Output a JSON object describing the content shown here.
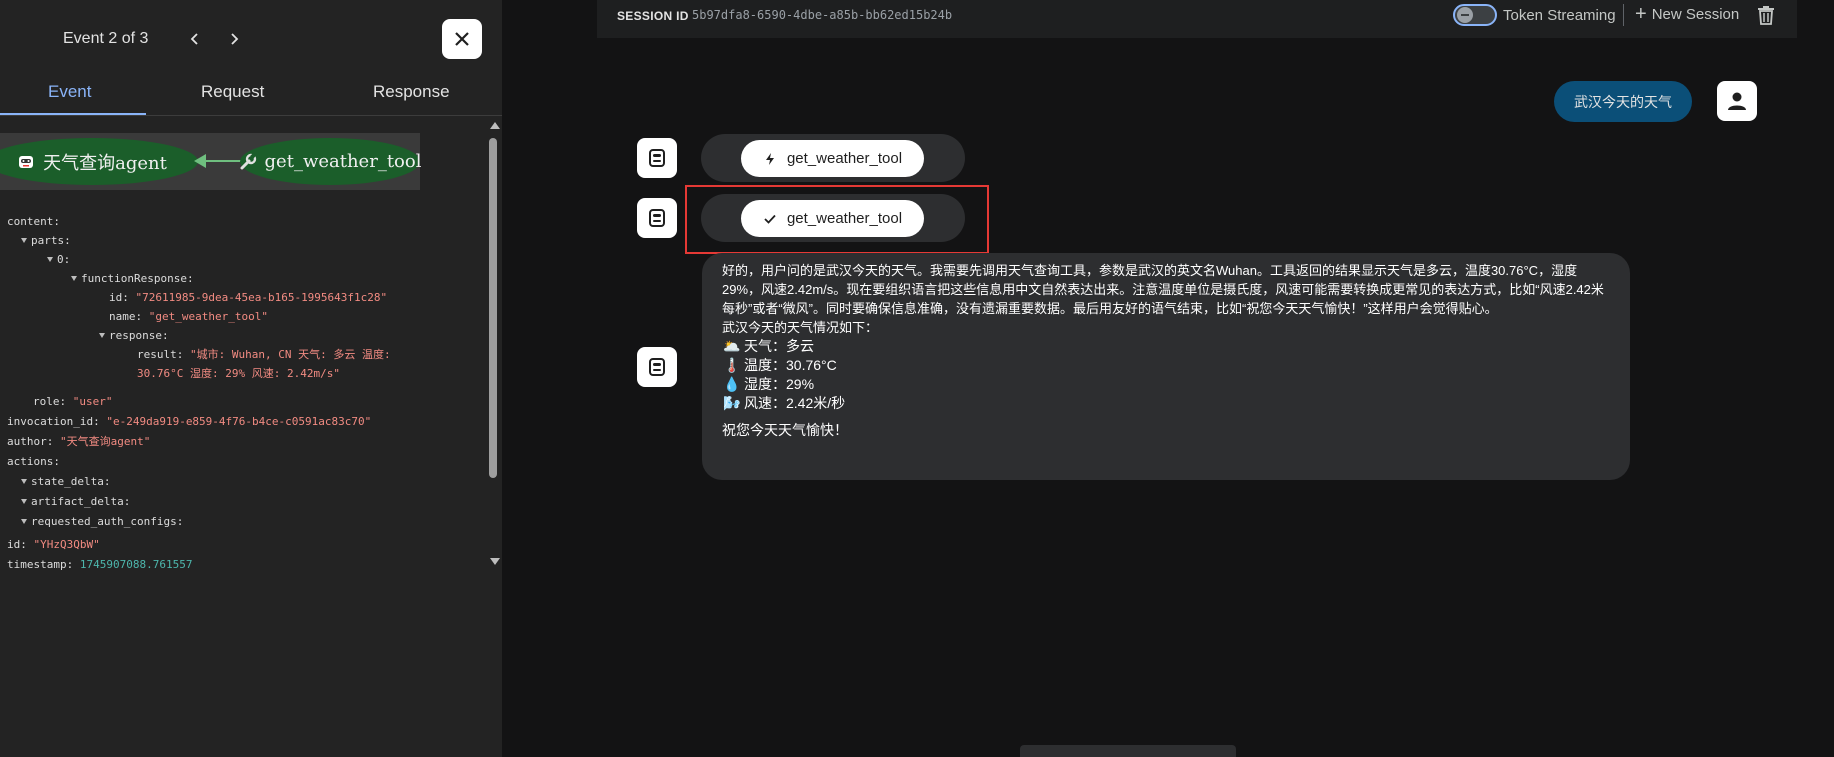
{
  "event_panel": {
    "title": "Event 2 of 3",
    "tabs": [
      "Event",
      "Request",
      "Response"
    ],
    "active_tab": "Event",
    "graph": {
      "agent_node": "天气查询agent",
      "tool_node": "get_weather_tool"
    },
    "json_lines": {
      "content": "content:",
      "parts": "parts:",
      "idx0": "0:",
      "functionResponse": "functionResponse:",
      "id_key": "id:",
      "id_val": "\"72611985-9dea-45ea-b165-1995643f1c28\"",
      "name_key": "name:",
      "name_val": "\"get_weather_tool\"",
      "response": "response:",
      "result_key": "result:",
      "result_val1": "\"城市: Wuhan, CN 天气: 多云 温度:",
      "result_val2": "30.76°C 湿度: 29% 风速: 2.42m/s\"",
      "role_key": "role:",
      "role_val": "\"user\"",
      "invocation_key": "invocation_id:",
      "invocation_val": "\"e-249da919-e859-4f76-b4ce-c0591ac83c70\"",
      "author_key": "author:",
      "author_val": "\"天气查询agent\"",
      "actions": "actions:",
      "state_delta": "state_delta:",
      "artifact_delta": "artifact_delta:",
      "requested_auth_configs": "requested_auth_configs:",
      "eid_key": "id:",
      "eid_val": "\"YHzQ3QbW\"",
      "timestamp_key": "timestamp:",
      "timestamp_val": "1745907088.761557"
    }
  },
  "session": {
    "label": "SESSION ID",
    "id": "5b97dfa8-6590-4dbe-a85b-bb62ed15b24b",
    "token_streaming_label": "Token Streaming",
    "token_streaming_on": false,
    "new_session_label": "New Session"
  },
  "chat": {
    "user_message": "武汉今天的天气",
    "tool_call_label": "get_weather_tool",
    "tool_response_label": "get_weather_tool",
    "answer": {
      "thinking": "好的，用户问的是武汉今天的天气。我需要先调用天气查询工具，参数是武汉的英文名Wuhan。工具返回的结果显示天气是多云，温度30.76°C，湿度29%，风速2.42m/s。现在要组织语言把这些信息用中文自然表达出来。注意温度单位是摄氏度，风速可能需要转换成更常见的表达方式，比如“风速2.42米每秒”或者“微风”。同时要确保信息准确，没有遗漏重要数据。最后用友好的语气结束，比如“祝您今天天气愉快！”这样用户会觉得贴心。",
      "intro": "武汉今天的天气情况如下：",
      "items": [
        {
          "icon": "sun-cloud-icon",
          "emoji": "🌥️",
          "text": "天气：多云"
        },
        {
          "icon": "thermometer-icon",
          "emoji": "🌡️",
          "text": "温度：30.76°C"
        },
        {
          "icon": "droplet-icon",
          "emoji": "💧",
          "text": "湿度：29%"
        },
        {
          "icon": "wind-icon",
          "emoji": "🌬️",
          "text": "风速：2.42米/秒"
        }
      ],
      "closing": "祝您今天天气愉快！"
    }
  },
  "colors": {
    "accent_blue": "#8ab4f8",
    "user_bubble": "#0b4f78",
    "graph_node": "#1b5e2a",
    "highlight_red": "#e53935",
    "string_red": "#f28b82",
    "number_teal": "#4db6ac"
  }
}
